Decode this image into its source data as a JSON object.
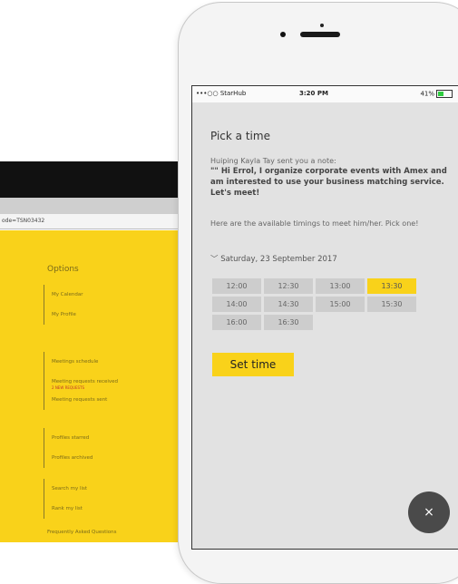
{
  "back_page": {
    "url": "ode=TSN03432",
    "options_title": "Options",
    "groups": [
      {
        "items": [
          {
            "label": "My Calendar"
          },
          {
            "label": "My Profile"
          }
        ]
      },
      {
        "items": [
          {
            "label": "Meetings schedule"
          },
          {
            "label": "Meeting requests received",
            "sub": "2 NEW REQUESTS"
          },
          {
            "label": "Meeting requests sent"
          }
        ]
      },
      {
        "items": [
          {
            "label": "Profiles starred"
          },
          {
            "label": "Profiles archived"
          }
        ]
      },
      {
        "items": [
          {
            "label": "Search my list"
          },
          {
            "label": "Rank my list"
          }
        ]
      }
    ],
    "faq_label": "Frequently Asked Questions"
  },
  "status_bar": {
    "carrier": "•••○○ StarHub",
    "time": "3:20 PM",
    "battery": "41%"
  },
  "screen": {
    "title": "Pick a time",
    "note_intro": "Huiping Kayla Tay sent you a note:",
    "note_text": "\"\" Hi Errol, I organize corporate events with Amex and am interested to use your business matching service. Let's meet!",
    "available_text": "Here are the available timings to meet him/her. Pick one!",
    "date_label": "Saturday, 23 September 2017",
    "time_slots": [
      "12:00",
      "12:30",
      "13:00",
      "13:30",
      "14:00",
      "14:30",
      "15:00",
      "15:30",
      "16:00",
      "16:30"
    ],
    "selected_slot": "13:30",
    "set_time_label": "Set time",
    "close_label": "×"
  },
  "colors": {
    "accent_yellow": "#f9d21a",
    "screen_background": "#e2e2e2",
    "slot_gray": "#cdcdcd",
    "fab_dark": "#4a4a4a"
  }
}
